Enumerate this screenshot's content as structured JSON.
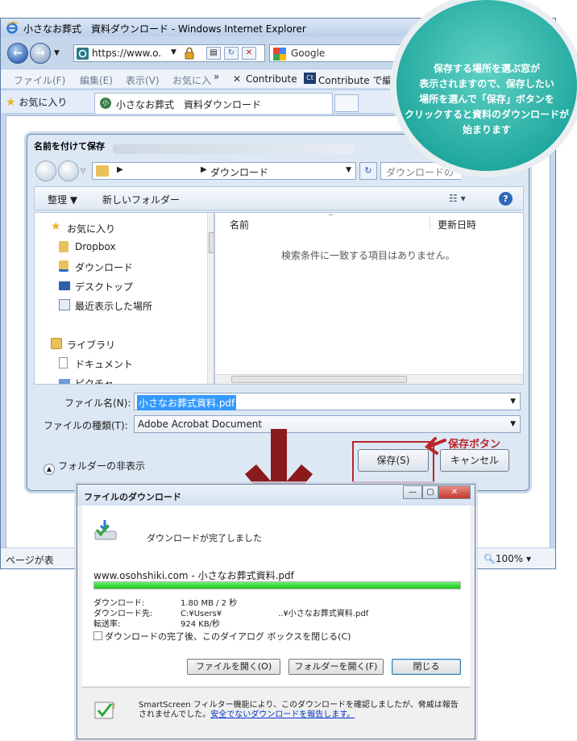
{
  "ie": {
    "title": "小さなお葬式　資料ダウンロード - Windows Internet Explorer",
    "address": "https://www.o.",
    "search_label": "Google",
    "menu": [
      "ファイル(F)",
      "編集(E)",
      "表示(V)",
      "お気に入",
      "»",
      "✕",
      "Contribute",
      "Contribute で編集"
    ],
    "favorites_label": "お気に入り",
    "tab_label": "小さなお葬式　資料ダウンロード",
    "status_left": "ページが表",
    "zoom": "100%"
  },
  "callout": {
    "lines": [
      "保存する場所を選ぶ窓が",
      "表示されますので、保存したい",
      "場所を選んで「保存」ボタンを",
      "クリックすると資料のダウンロードが",
      "始まります"
    ],
    "save_button_label": "保存ボタン",
    "accent_color": "#1fa79d",
    "arrow_color": "#8b1a1a"
  },
  "save_dialog": {
    "title": "名前を付けて保存",
    "breadcrumb": "ダウンロード",
    "search_placeholder": "ダウンロードの",
    "organize": "整理 ▼",
    "new_folder": "新しいフォルダー",
    "nav": [
      "お気に入り",
      "Dropbox",
      "ダウンロード",
      "デスクトップ",
      "最近表示した場所",
      "ライブラリ",
      "ドキュメント",
      "ピクチャ"
    ],
    "col_name": "名前",
    "col_date": "更新日時",
    "empty_message": "検索条件に一致する項目はありません。",
    "filename_label": "ファイル名(N):",
    "filename_value": "小さなお葬式資料.pdf",
    "filetype_label": "ファイルの種類(T):",
    "filetype_value": "Adobe Acrobat Document",
    "hide_folders": "フォルダーの非表示",
    "save_btn": "保存(S)",
    "cancel_btn": "キャンセル"
  },
  "download_dialog": {
    "title": "ファイルのダウンロード",
    "status": "ダウンロードが完了しました",
    "file": "www.osohshiki.com - 小さなお葬式資料.pdf",
    "progress_percent": 100,
    "rows": [
      {
        "k": "ダウンロード:",
        "v": "1.80 MB / 2 秒"
      },
      {
        "k": "ダウンロード先:",
        "v": "C:¥Users¥　　　　　　　..¥小さなお葬式資料.pdf"
      },
      {
        "k": "転送率:",
        "v": "924 KB/秒"
      }
    ],
    "close_on_complete": "ダウンロードの完了後、このダイアログ ボックスを閉じる(C)",
    "open_file": "ファイルを開く(O)",
    "open_folder": "フォルダーを開く(F)",
    "close": "閉じる",
    "smartscreen_text": "SmartScreen フィルター機能により、このダウンロードを確認しましたが、脅威は報告されませんでした。",
    "smartscreen_link": "安全でないダウンロードを報告します。"
  }
}
